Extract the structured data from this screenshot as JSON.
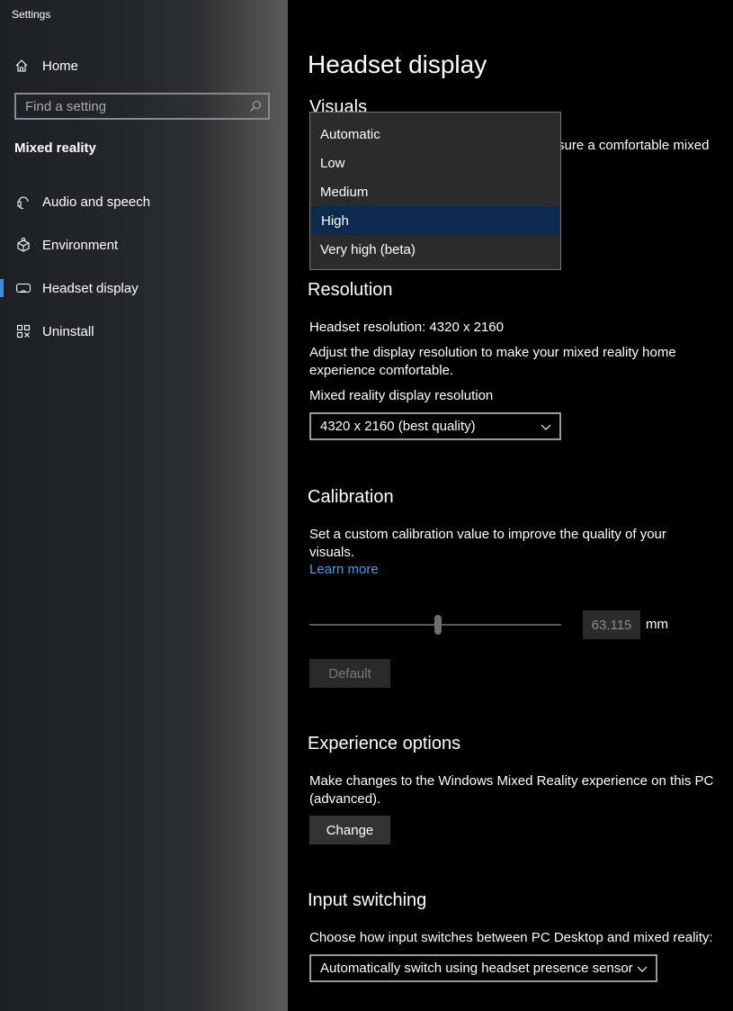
{
  "window": {
    "title": "Settings"
  },
  "sidebar": {
    "home_label": "Home",
    "search": {
      "placeholder": "Find a setting"
    },
    "section_title": "Mixed reality",
    "items": [
      {
        "label": "Audio and speech",
        "icon": "headset-mic-icon"
      },
      {
        "label": "Environment",
        "icon": "environment-icon"
      },
      {
        "label": "Headset display",
        "icon": "headset-icon",
        "active": true
      },
      {
        "label": "Uninstall",
        "icon": "uninstall-icon"
      }
    ],
    "accent_color": "#3b8de0"
  },
  "main": {
    "title": "Headset display",
    "visuals": {
      "heading": "Visuals",
      "partial_text": "sure a comfortable mixed",
      "dropdown": {
        "options": [
          "Automatic",
          "Low",
          "Medium",
          "High",
          "Very high (beta)"
        ],
        "selected": "High",
        "selected_color": "#0e2a4f"
      }
    },
    "resolution": {
      "heading": "Resolution",
      "headset_resolution": "Headset resolution: 4320 x 2160",
      "description": "Adjust the display resolution to make your mixed reality home experience comfortable.",
      "select_label": "Mixed reality display resolution",
      "select_value": "4320 x 2160 (best quality)"
    },
    "calibration": {
      "heading": "Calibration",
      "description": "Set a custom calibration value to improve the quality of your visuals.",
      "learn_more": "Learn more",
      "value": "63.115",
      "unit": "mm",
      "slider_fraction": 0.51,
      "default_button": "Default"
    },
    "experience": {
      "heading": "Experience options",
      "description": "Make changes to the Windows Mixed Reality experience on this PC (advanced).",
      "change_button": "Change"
    },
    "input_switching": {
      "heading": "Input switching",
      "description": "Choose how input switches between PC Desktop and mixed reality:",
      "select_value": "Automatically switch using headset presence sensor"
    }
  }
}
